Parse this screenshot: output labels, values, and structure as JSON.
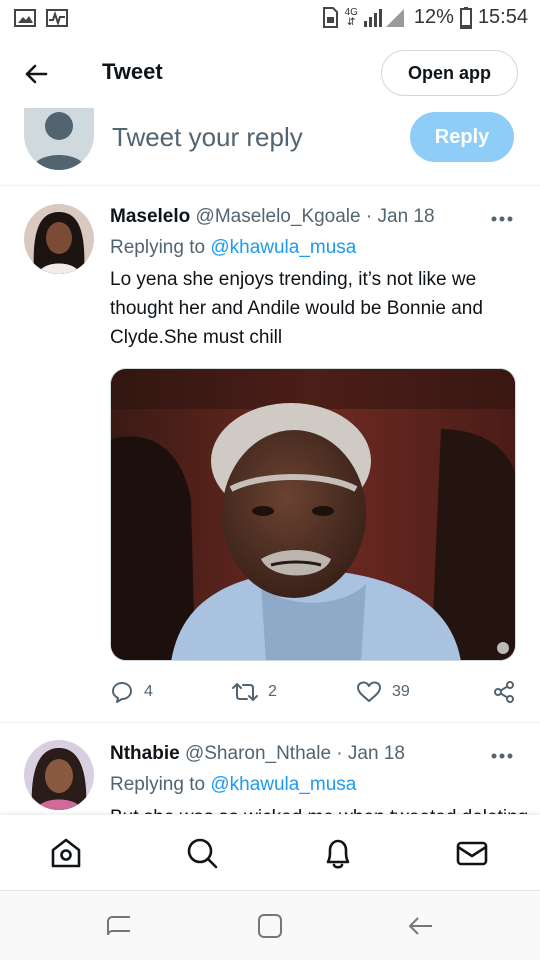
{
  "status_bar": {
    "network": "4G",
    "battery": "12%",
    "time": "15:54"
  },
  "header": {
    "title": "Tweet",
    "open_app_label": "Open app"
  },
  "compose": {
    "placeholder": "Tweet your reply",
    "reply_label": "Reply"
  },
  "tweets": [
    {
      "name": "Maselelo",
      "handle": "@Maselelo_Kgoale",
      "date": "Jan 18",
      "replying_prefix": "Replying to",
      "replying_to": "@khawula_musa",
      "text": "Lo yena she enjoys trending, it’s not like we thought her and Andile would be Bonnie and Clyde.She must chill",
      "replies": "4",
      "retweets": "2",
      "likes": "39"
    },
    {
      "name": "Nthabie",
      "handle": "@Sharon_Nthale",
      "date": "Jan 18",
      "replying_prefix": "Replying to",
      "replying_to": "@khawula_musa",
      "text_cut": "But she was so wicked me when tweeted deleting"
    }
  ],
  "separator": "·",
  "icons": {
    "back": "arrow-left-icon",
    "more": "more-dots-icon",
    "reply": "reply-bubble-icon",
    "retweet": "retweet-icon",
    "like": "heart-icon",
    "share": "share-icon",
    "home": "home-icon",
    "search": "search-icon",
    "notifications": "bell-icon",
    "messages": "mail-icon"
  },
  "colors": {
    "accent": "#1d9bf0",
    "reply_button": "#8ecdf8",
    "secondary_text": "#536471"
  }
}
